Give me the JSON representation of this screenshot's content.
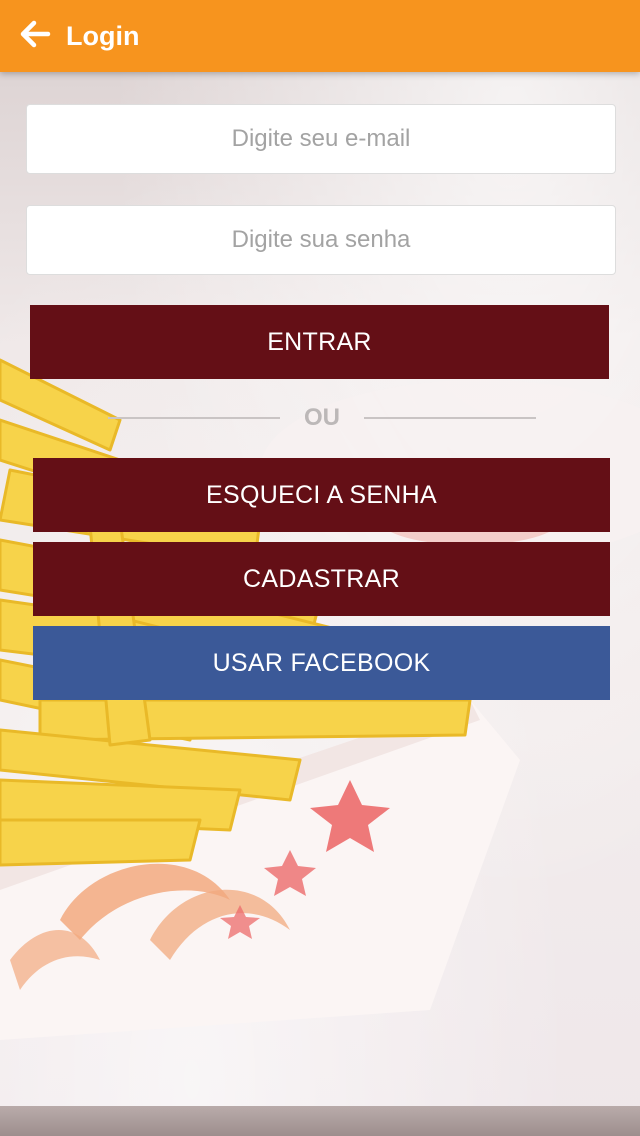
{
  "header": {
    "title": "Login"
  },
  "form": {
    "email_placeholder": "Digite seu e-mail",
    "email_value": "",
    "password_placeholder": "Digite sua senha",
    "password_value": ""
  },
  "buttons": {
    "login": "ENTRAR",
    "separator": "OU",
    "forgot": "ESQUECI A SENHA",
    "register": "CADASTRAR",
    "facebook": "USAR FACEBOOK"
  },
  "colors": {
    "accent": "#f7941e",
    "primary_button": "#640f16",
    "facebook_button": "#3b5998"
  },
  "icons": {
    "back": "arrow-left-icon"
  }
}
